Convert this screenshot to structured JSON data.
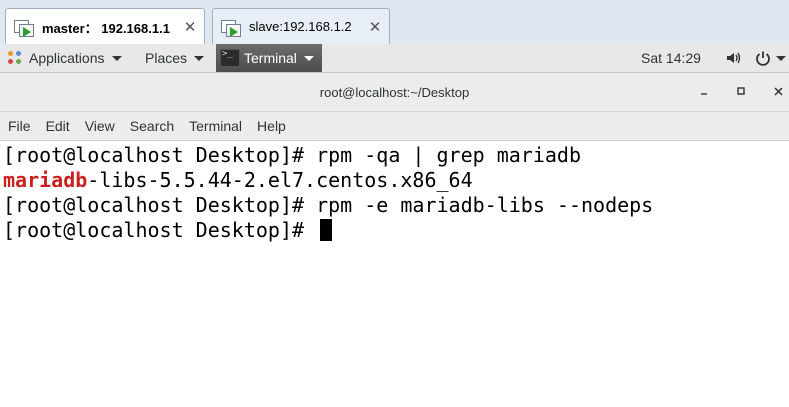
{
  "vm_tabs": [
    {
      "label": "master： 192.168.1.1",
      "active": true
    },
    {
      "label": "slave:192.168.1.2",
      "active": false
    }
  ],
  "topbar": {
    "applications": "Applications",
    "places": "Places",
    "terminal": "Terminal",
    "clock": "Sat 14:29"
  },
  "window": {
    "title": "root@localhost:~/Desktop"
  },
  "menu": [
    "File",
    "Edit",
    "View",
    "Search",
    "Terminal",
    "Help"
  ],
  "terminal": {
    "lines": [
      {
        "prompt": "[root@localhost Desktop]# ",
        "command": "rpm -qa | grep mariadb"
      },
      {
        "highlight": "mariadb",
        "rest": "-libs-5.5.44-2.el7.centos.x86_64"
      },
      {
        "prompt": "[root@localhost Desktop]# ",
        "command": "rpm -e mariadb-libs --nodeps"
      },
      {
        "prompt": "[root@localhost Desktop]# ",
        "command": ""
      }
    ]
  },
  "colors": {
    "grep_match": "#cc1f1f",
    "run_icon": "#2e9e2e"
  }
}
